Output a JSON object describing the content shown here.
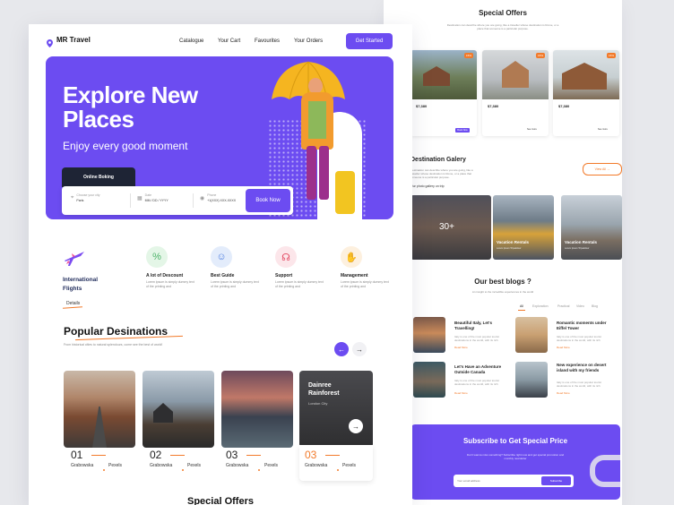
{
  "nav": {
    "brand": "MR Travel",
    "links": [
      "Catalogue",
      "Your Cart",
      "Favourites",
      "Your Orders"
    ],
    "cta": "Get Started"
  },
  "hero": {
    "title_line1": "Explore New",
    "title_line2": "Places",
    "subtitle": "Enjoy every good moment",
    "booking_tab": "Online Boking",
    "fields": [
      {
        "label": "Choose your city",
        "value": "Paris"
      },
      {
        "label": "Date",
        "value": "MM / DD / YYYY"
      },
      {
        "label": "Phone",
        "value": "+1(XXX) XXX-XXXX"
      }
    ],
    "book_button": "Book Now"
  },
  "features": {
    "intro_line1": "International",
    "intro_line2": "Flights",
    "intro_link": "Details",
    "items": [
      {
        "title": "A lot of Descount",
        "desc": "Lorem ipsum is simply dummy text of the printing and",
        "icon": "percent-tag-icon",
        "color": "#E4F6E7"
      },
      {
        "title": "Best Guide",
        "desc": "Lorem ipsum is simply dummy text of the printing and",
        "icon": "guide-person-icon",
        "color": "#E3ECFB"
      },
      {
        "title": "Support",
        "desc": "Lorem ipsum is simply dummy text of the printing and",
        "icon": "headset-icon",
        "color": "#FCE6EA"
      },
      {
        "title": "Management",
        "desc": "Lorem ipsum is simply dummy text of the printing and",
        "icon": "handshake-icon",
        "color": "#FDF0DE"
      }
    ]
  },
  "popular": {
    "title": "Popular Desinations",
    "subtitle": "From historical cities to natural splendours, come see the best of world!",
    "featured": {
      "name_line1": "Dainree",
      "name_line2": "Rainforest",
      "sub": "London City"
    },
    "cards": [
      {
        "num": "01",
        "author": "Grabowska",
        "source": "Pexels"
      },
      {
        "num": "02",
        "author": "Grabowska",
        "source": "Pexels"
      },
      {
        "num": "03",
        "author": "Grabowska",
        "source": "Pexels"
      },
      {
        "num": "03",
        "author": "Grabowska",
        "source": "Pexels"
      }
    ]
  },
  "special_offers_bottom": "Special Offers",
  "right": {
    "offers_title": "Special Offers",
    "offers_sub": "Destination can describe where you are going, like a traveller whose destination is Rome, or a place that someone is a particular purpose.",
    "offer_prices": [
      "$7,380",
      "$7,380",
      "$7,380"
    ],
    "offer_tag": "15%",
    "offer_button": "Book Now",
    "offer_link": "See more",
    "gallery_title": "Destination Galery",
    "gallery_sub": "Destination can describe where you are going, like a traveller whose destination is Rome, or a place that someone is a particular purpose.",
    "gallery_link": "Our photo gallery on trip",
    "view_all": "View All",
    "gallery": [
      {
        "label": "30+"
      },
      {
        "label": "Vacation Rentals",
        "sub": "Lorem Ipsum Tripadvisor"
      },
      {
        "label": "Vacation Rentals",
        "sub": "Lorem Ipsum Tripadvisor"
      }
    ],
    "blogs_title": "Our best blogs ?",
    "blogs_sub": "An insight to the incredible experiences in the world",
    "tabs": [
      "All",
      "Exploration",
      "Practical",
      "Video",
      "Blog"
    ],
    "blogs": [
      {
        "title": "Beautiful Italy, Let's Travelling!",
        "desc": "Italy is one of the most popular tourist destinations in the world, with its rich",
        "more": "Read More"
      },
      {
        "title": "Romantic moments under Eiffel Tower",
        "desc": "Italy is one of the most popular tourist destinations in the world, with its rich",
        "more": "Read More"
      },
      {
        "title": "Let's Have an Adventure Outside Canada",
        "desc": "Italy is one of the most popular tourist destinations in the world, with its rich",
        "more": "Read More"
      },
      {
        "title": "New experience on desert island with my friends",
        "desc": "Italy is one of the most popular tourist destinations in the world, with its rich",
        "more": "Read More"
      }
    ],
    "subscribe_title": "Subscribe to Get Special Price",
    "subscribe_sub": "Don't wanna miss something? Subscribe right now and get special promotion and monthly newsletter",
    "email_placeholder": "Your email address",
    "subscribe_button": "Subscribe"
  },
  "colors": {
    "accent": "#6C4CF1",
    "orange": "#F27A2A"
  }
}
